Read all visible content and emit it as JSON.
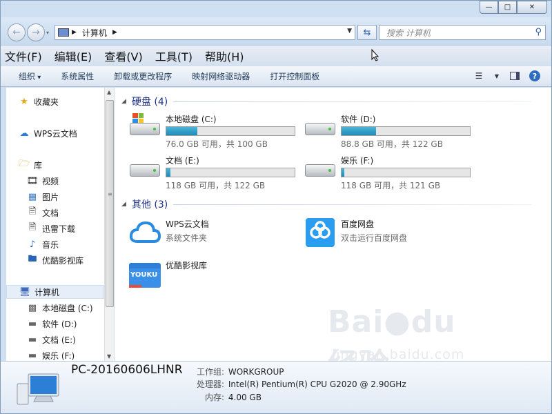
{
  "window": {
    "controls": {
      "minimize": "—",
      "maximize": "□",
      "close": "✕"
    }
  },
  "address": {
    "crumb": "计算机",
    "search_placeholder": "搜索 计算机"
  },
  "menu": [
    "文件(F)",
    "编辑(E)",
    "查看(V)",
    "工具(T)",
    "帮助(H)"
  ],
  "toolbar": [
    "组织",
    "系统属性",
    "卸载或更改程序",
    "映射网络驱动器",
    "打开控制面板"
  ],
  "nav": {
    "favorites": "收藏夹",
    "wps": "WPS云文档",
    "library": "库",
    "lib_items": [
      "视频",
      "图片",
      "文档",
      "迅雷下载",
      "音乐",
      "优酷影视库"
    ],
    "computer": "计算机",
    "drives": [
      "本地磁盘 (C:)",
      "软件 (D:)",
      "文档 (E:)",
      "娱乐 (F:)"
    ]
  },
  "content": {
    "hdd_group": "硬盘 (4)",
    "other_group": "其他 (3)",
    "drives": [
      {
        "name": "本地磁盘 (C:)",
        "free": "76.0 GB 可用，共 100 GB",
        "used_fraction": 0.24
      },
      {
        "name": "软件 (D:)",
        "free": "88.8 GB 可用，共 122 GB",
        "used_fraction": 0.27
      },
      {
        "name": "文档 (E:)",
        "free": "118 GB 可用，共 122 GB",
        "used_fraction": 0.03
      },
      {
        "name": "娱乐 (F:)",
        "free": "118 GB 可用，共 121 GB",
        "used_fraction": 0.02
      }
    ],
    "others": [
      {
        "name": "WPS云文档",
        "sub": "系统文件夹"
      },
      {
        "name": "百度网盘",
        "sub": "双击运行百度网盘"
      },
      {
        "name": "优酷影视库",
        "sub": ""
      }
    ],
    "youku_logo": "YOUKU"
  },
  "details": {
    "pc_name": "PC-20160606LHNR",
    "workgroup_label": "工作组:",
    "workgroup": "WORKGROUP",
    "cpu_label": "处理器:",
    "cpu": "Intel(R) Pentium(R) CPU G2020 @ 2.90GHz",
    "mem_label": "内存:",
    "mem": "4.00 GB"
  },
  "watermark": {
    "logo": "Bai●du 经验",
    "url": "jingyan.baidu.com"
  },
  "colors": {
    "accent": "#2d6cc0",
    "bar_fill": "#2a9ccc",
    "group_title": "#1e3287"
  }
}
